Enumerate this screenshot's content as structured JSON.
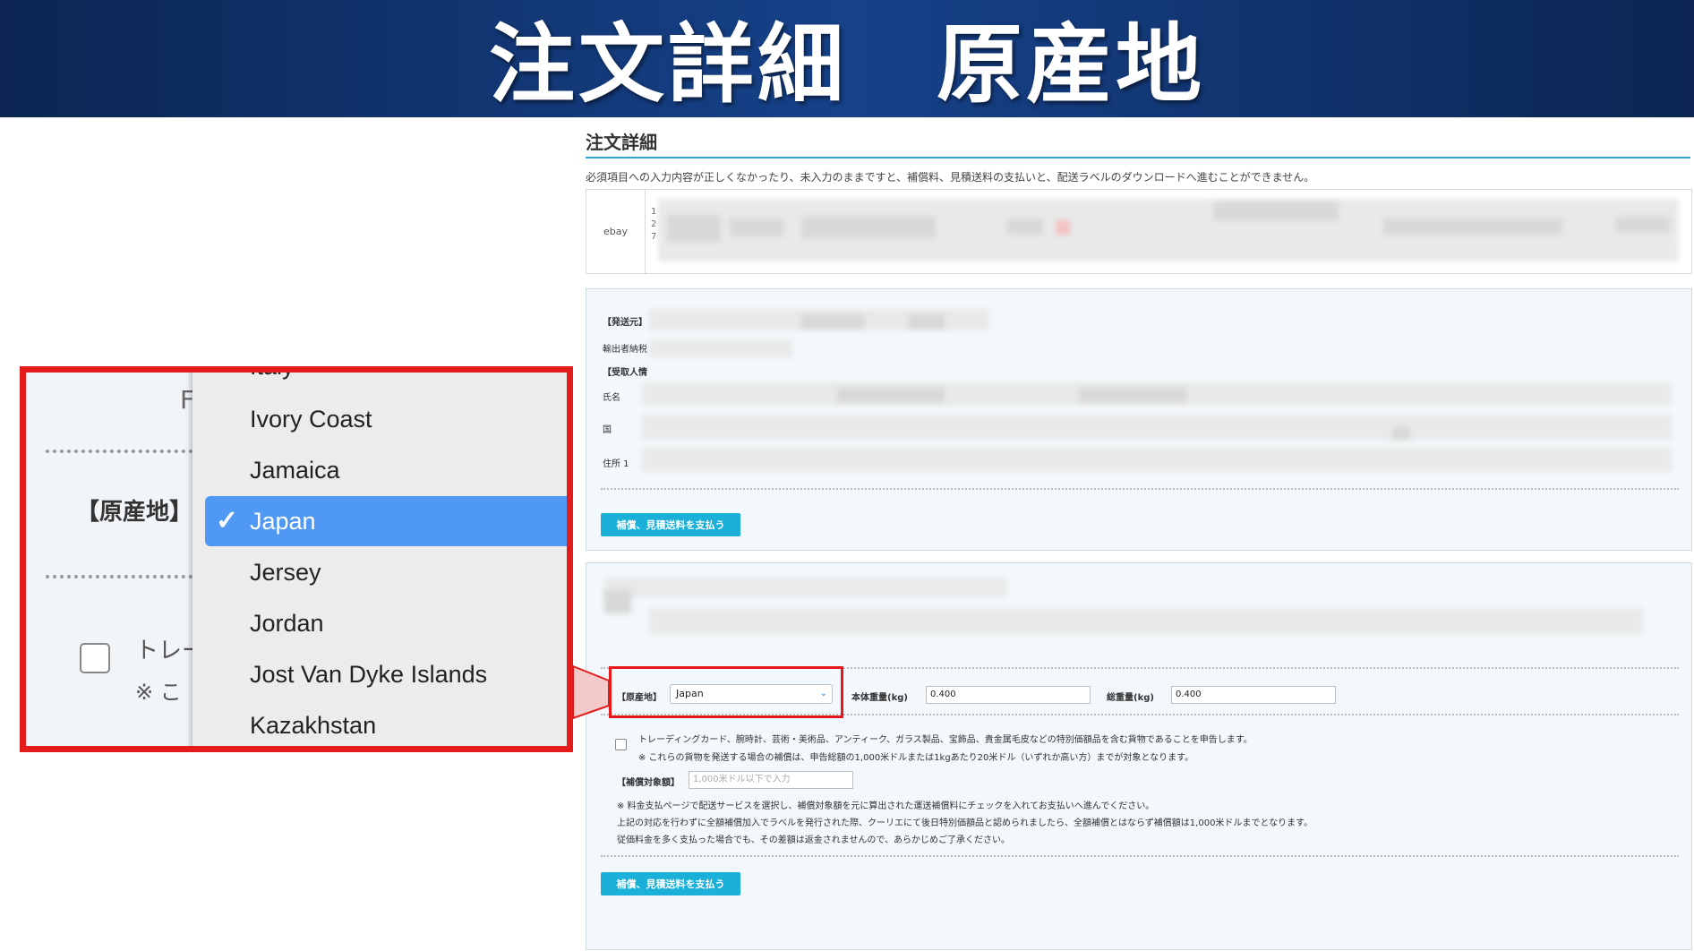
{
  "banner": {
    "title": "注文詳細　原産地"
  },
  "page": {
    "heading": "注文詳細",
    "warning": "必須項目への入力内容が正しくなかったり、未入力のままですと、補償料、見積送料の支払いと、配送ラベルのダウンロードへ進むことができません。",
    "ebay_label": "ebay",
    "ebay_digits": [
      "1",
      "2",
      "7"
    ],
    "panel1": {
      "sender_label": "【発送元】",
      "exporter_label": "輸出者納税",
      "recipient_label": "【受取人情",
      "name_label": "氏名",
      "country_label": "国",
      "address_label": "住所 1",
      "pay_button": "補償、見積送料を支払う"
    },
    "panel2": {
      "origin_label": "【原産地】",
      "origin_value": "Japan",
      "net_weight_label": "本体重量(kg)",
      "net_weight_value": "0.400",
      "gross_weight_label": "総重量(kg)",
      "gross_weight_value": "0.400",
      "declare_text": "トレーディングカード、腕時計、芸術・美術品、アンティーク、ガラス製品、宝飾品、貴金属毛皮などの特別価額品を含む貨物であることを申告します。",
      "declare_note": "※ これらの貨物を発送する場合の補償は、申告総額の1,000米ドルまたは1kgあたり20米ドル（いずれか高い方）までが対象となります。",
      "coverage_label": "【補償対象額】",
      "coverage_placeholder": "1,000米ドル以下で入力",
      "note1": "※ 料金支払ページで配送サービスを選択し、補償対象額を元に算出された運送補償料にチェックを入れてお支払いへ進んでください。",
      "note2": "上記の対応を行わずに全額補償加入でラベルを発行された際、クーリエにて後日特別価額品と認められましたら、全額補償とはならず補償額は1,000米ドルまでとなります。",
      "note3": "従価料金を多く支払った場合でも、その差額は返金されませんので、あらかじめご了承ください。",
      "pay_button": "補償、見積送料を支払う"
    }
  },
  "zoom": {
    "partial_label": "F",
    "origin_label": "【原産地】",
    "trade_text_partial": "トレー",
    "note_partial": "※ こ",
    "options_partial_top": "Italy",
    "options": [
      {
        "label": "Ivory Coast",
        "selected": false
      },
      {
        "label": "Jamaica",
        "selected": false
      },
      {
        "label": "Japan",
        "selected": true
      },
      {
        "label": "Jersey",
        "selected": false
      },
      {
        "label": "Jordan",
        "selected": false
      },
      {
        "label": "Jost Van Dyke Islands",
        "selected": false
      },
      {
        "label": "Kazakhstan",
        "selected": false
      }
    ],
    "check_glyph": "✓"
  },
  "colors": {
    "highlight": "#e31b1b",
    "selected_option": "#4f98f4",
    "pay_button": "#1ab0d8",
    "banner": "#0c2552"
  }
}
